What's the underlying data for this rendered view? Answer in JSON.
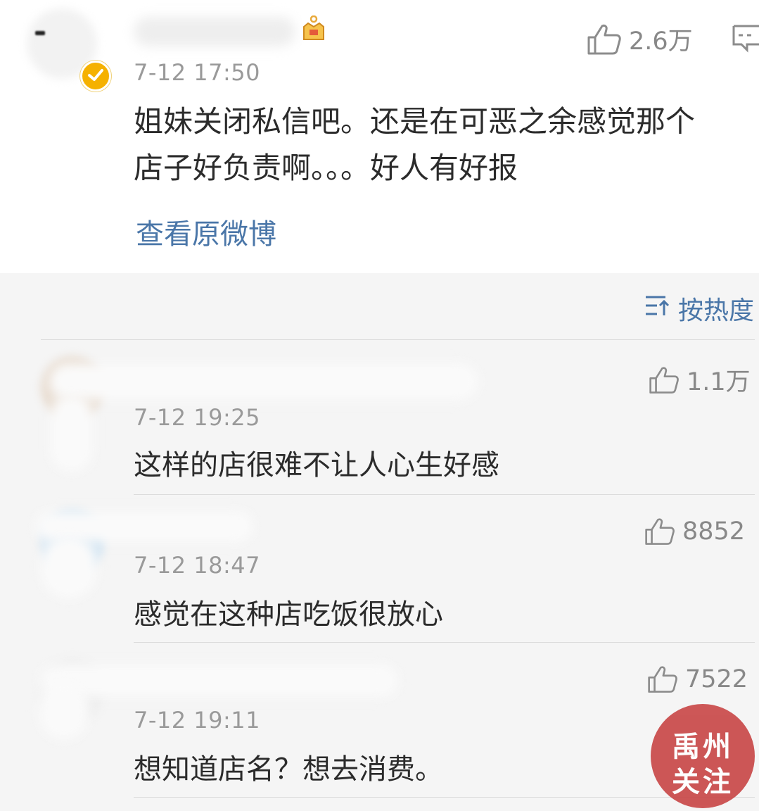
{
  "post": {
    "time": "7-12 17:50",
    "likes": "2.6万",
    "text_line1": "姐妹关闭私信吧。还是在可恶之余感觉那个",
    "text_line2": "店子好负责啊。。。好人有好报",
    "view_original": "查看原微博"
  },
  "sort": {
    "label": "按热度"
  },
  "comments": [
    {
      "time": "7-12 19:25",
      "likes": "1.1万",
      "text": "这样的店很难不让人心生好感"
    },
    {
      "time": "7-12 18:47",
      "likes": "8852",
      "text": "感觉在这种店吃饭很放心"
    },
    {
      "time": "7-12 19:11",
      "likes": "7522",
      "text": "想知道店名？想去消费。"
    }
  ],
  "watermark": {
    "line1": "禹州",
    "line2": "关注"
  },
  "colors": {
    "link": "#4a76a8",
    "verified": "#f5b100",
    "badge": "#c94a4a"
  },
  "icons": [
    "thumbs-up-icon",
    "comment-icon",
    "sort-icon",
    "verified-badge-icon",
    "crown-icon"
  ]
}
